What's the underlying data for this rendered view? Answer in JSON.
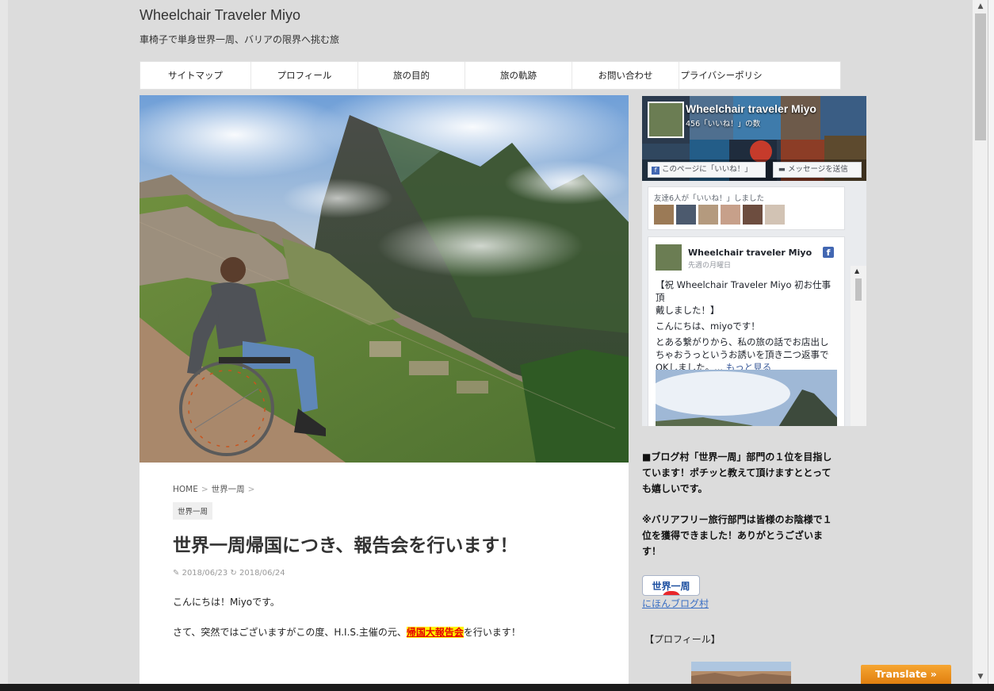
{
  "site": {
    "title": "Wheelchair Traveler Miyo",
    "description": "車椅子で単身世界一周、バリアの限界へ挑む旅"
  },
  "nav": {
    "items": [
      {
        "label": "サイトマップ"
      },
      {
        "label": "プロフィール"
      },
      {
        "label": "旅の目的"
      },
      {
        "label": "旅の軌跡"
      },
      {
        "label": "お問い合わせ"
      },
      {
        "label": "プライバシーポリシー"
      }
    ]
  },
  "article": {
    "breadcrumb": {
      "home": "HOME",
      "category": "世界一周",
      "sep": ">"
    },
    "category_tag": "世界一周",
    "title": "世界一周帰国につき、報告会を行います！",
    "published": "2018/06/23",
    "updated": "2018/06/24",
    "para1": "こんにちは！Miyoです。",
    "para2_before": "さて、突然ではございますがこの度、H.I.S.主催の元、",
    "para2_highlight": "帰国大報告会",
    "para2_after": "を行います！"
  },
  "facebook": {
    "page_name": "Wheelchair traveler Miyo",
    "likes": "456「いいね！」の数",
    "like_button": "このページに「いいね！」",
    "message_button": "メッセージを送信",
    "friends_text": "友達6人が「いいね！」しました",
    "post": {
      "author": "Wheelchair traveler Miyo",
      "time": "先週の月曜日",
      "line1": "【祝 Wheelchair Traveler Miyo 初お仕事頂",
      "line2": "戴しました！】",
      "line3": "こんにちは、miyoです！",
      "line4": "とある繋がりから、私の旅の話でお店出し",
      "line5": "ちゃおうっというお誘いを頂き二つ返事で",
      "line6_before": "OKしました。... ",
      "more": "もっと見る"
    }
  },
  "sidebar": {
    "text1_l1": "■ブログ村「世界一周」部門の１位を目指し",
    "text1_l2": "ています！ポチッと教えて頂けますととって",
    "text1_l3": "も嬉しいです。",
    "text2_l1": "※バリアフリー旅行部門は皆様のお陰様で１",
    "text2_l2": "位を獲得できました！ありがとうございま",
    "text2_l3": "す！",
    "banner_label": "世界一周",
    "blogmura_link": "にほんブログ村",
    "profile_heading": "【プロフィール】"
  },
  "translate": {
    "label": "Translate »"
  },
  "colors": {
    "accent_highlight": "#fff200",
    "highlight_text": "#e60000",
    "link": "#385898",
    "facebook_blue": "#4267b2",
    "translate_orange": "#f39c1f"
  }
}
